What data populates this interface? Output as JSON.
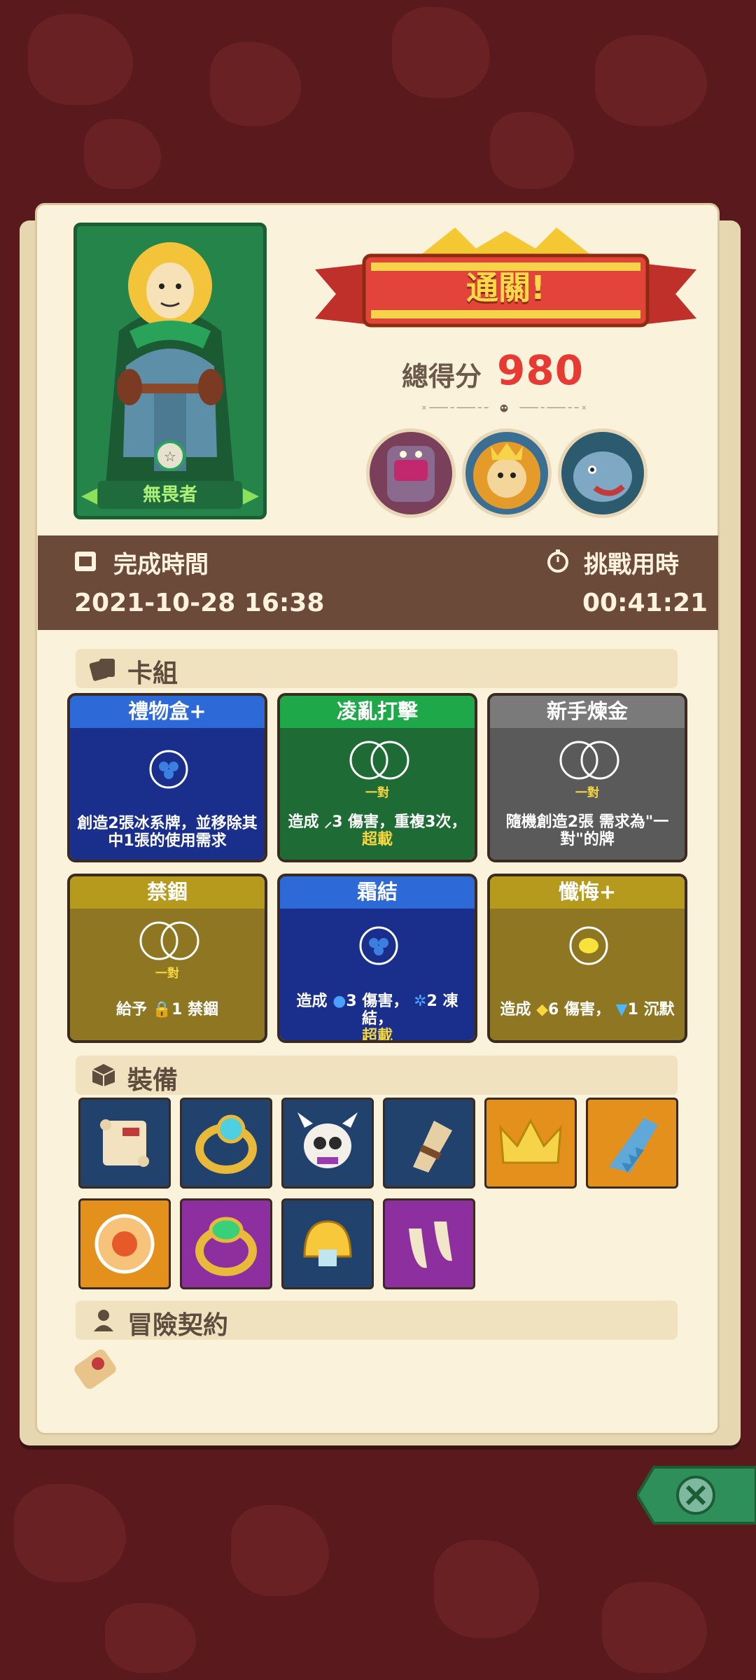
{
  "result": {
    "banner": "通關!",
    "score_label": "總得分",
    "score_value": "980"
  },
  "hero": {
    "name": "無畏者"
  },
  "bosses": [
    {
      "name": "boss-1"
    },
    {
      "name": "boss-2"
    },
    {
      "name": "boss-3"
    }
  ],
  "info": {
    "finish_label": "完成時間",
    "finish_value": "2021-10-28 16:38",
    "duration_label": "挑戰用時",
    "duration_value": "00:41:21"
  },
  "sections": {
    "deck": "卡組",
    "equipment": "裝備",
    "contract": "冒險契約"
  },
  "deck": [
    {
      "title": "禮物盒+",
      "desc": "創造2張冰系牌，並移除其中1張的使用需求",
      "tag": "",
      "color": "#1a2f8c",
      "title_color": "#2d6ad8"
    },
    {
      "title": "凌亂打擊",
      "desc_a": "造成",
      "desc_b": "3 傷害，重複3次，",
      "desc_hl": "超載",
      "tag": "一對",
      "color": "#1f6b35",
      "title_color": "#1fa84a"
    },
    {
      "title": "新手煉金",
      "desc": "隨機創造2張 需求為\"一對\"的牌",
      "tag": "一對",
      "color": "#5a5a5a",
      "title_color": "#7a7a7a"
    },
    {
      "title": "禁錮",
      "desc_a": "給予",
      "desc_b": "1 禁錮",
      "tag": "一對",
      "color": "#8e7622",
      "title_color": "#b69a1e"
    },
    {
      "title": "霜結",
      "desc_a": "造成",
      "desc_b": "3 傷害，",
      "desc_c": "2 凍結，",
      "desc_hl": "超載",
      "tag": "",
      "color": "#1a2f8c",
      "title_color": "#2d6ad8"
    },
    {
      "title": "懺悔+",
      "desc_a": "造成",
      "desc_b": "6 傷害，",
      "desc_c": "1 沉默",
      "tag": "",
      "color": "#8e7622",
      "title_color": "#b69a1e"
    }
  ],
  "equipment": [
    {
      "icon": "scroll-icon",
      "bg": "#22426e"
    },
    {
      "icon": "gold-ring-icon",
      "bg": "#22426e"
    },
    {
      "icon": "horned-skull-icon",
      "bg": "#22426e"
    },
    {
      "icon": "horn-icon",
      "bg": "#22426e"
    },
    {
      "icon": "crown-icon",
      "bg": "#e3901c"
    },
    {
      "icon": "saw-blade-icon",
      "bg": "#e3901c"
    },
    {
      "icon": "orange-disc-icon",
      "bg": "#e3901c"
    },
    {
      "icon": "emerald-ring-icon",
      "bg": "#8e2fa0"
    },
    {
      "icon": "golden-helmet-icon",
      "bg": "#22426e"
    },
    {
      "icon": "fangs-icon",
      "bg": "#8e2fa0"
    }
  ],
  "colors": {
    "accent": "#e63a32",
    "panel": "#fbf2dc",
    "infobar": "#6b4a3a"
  }
}
